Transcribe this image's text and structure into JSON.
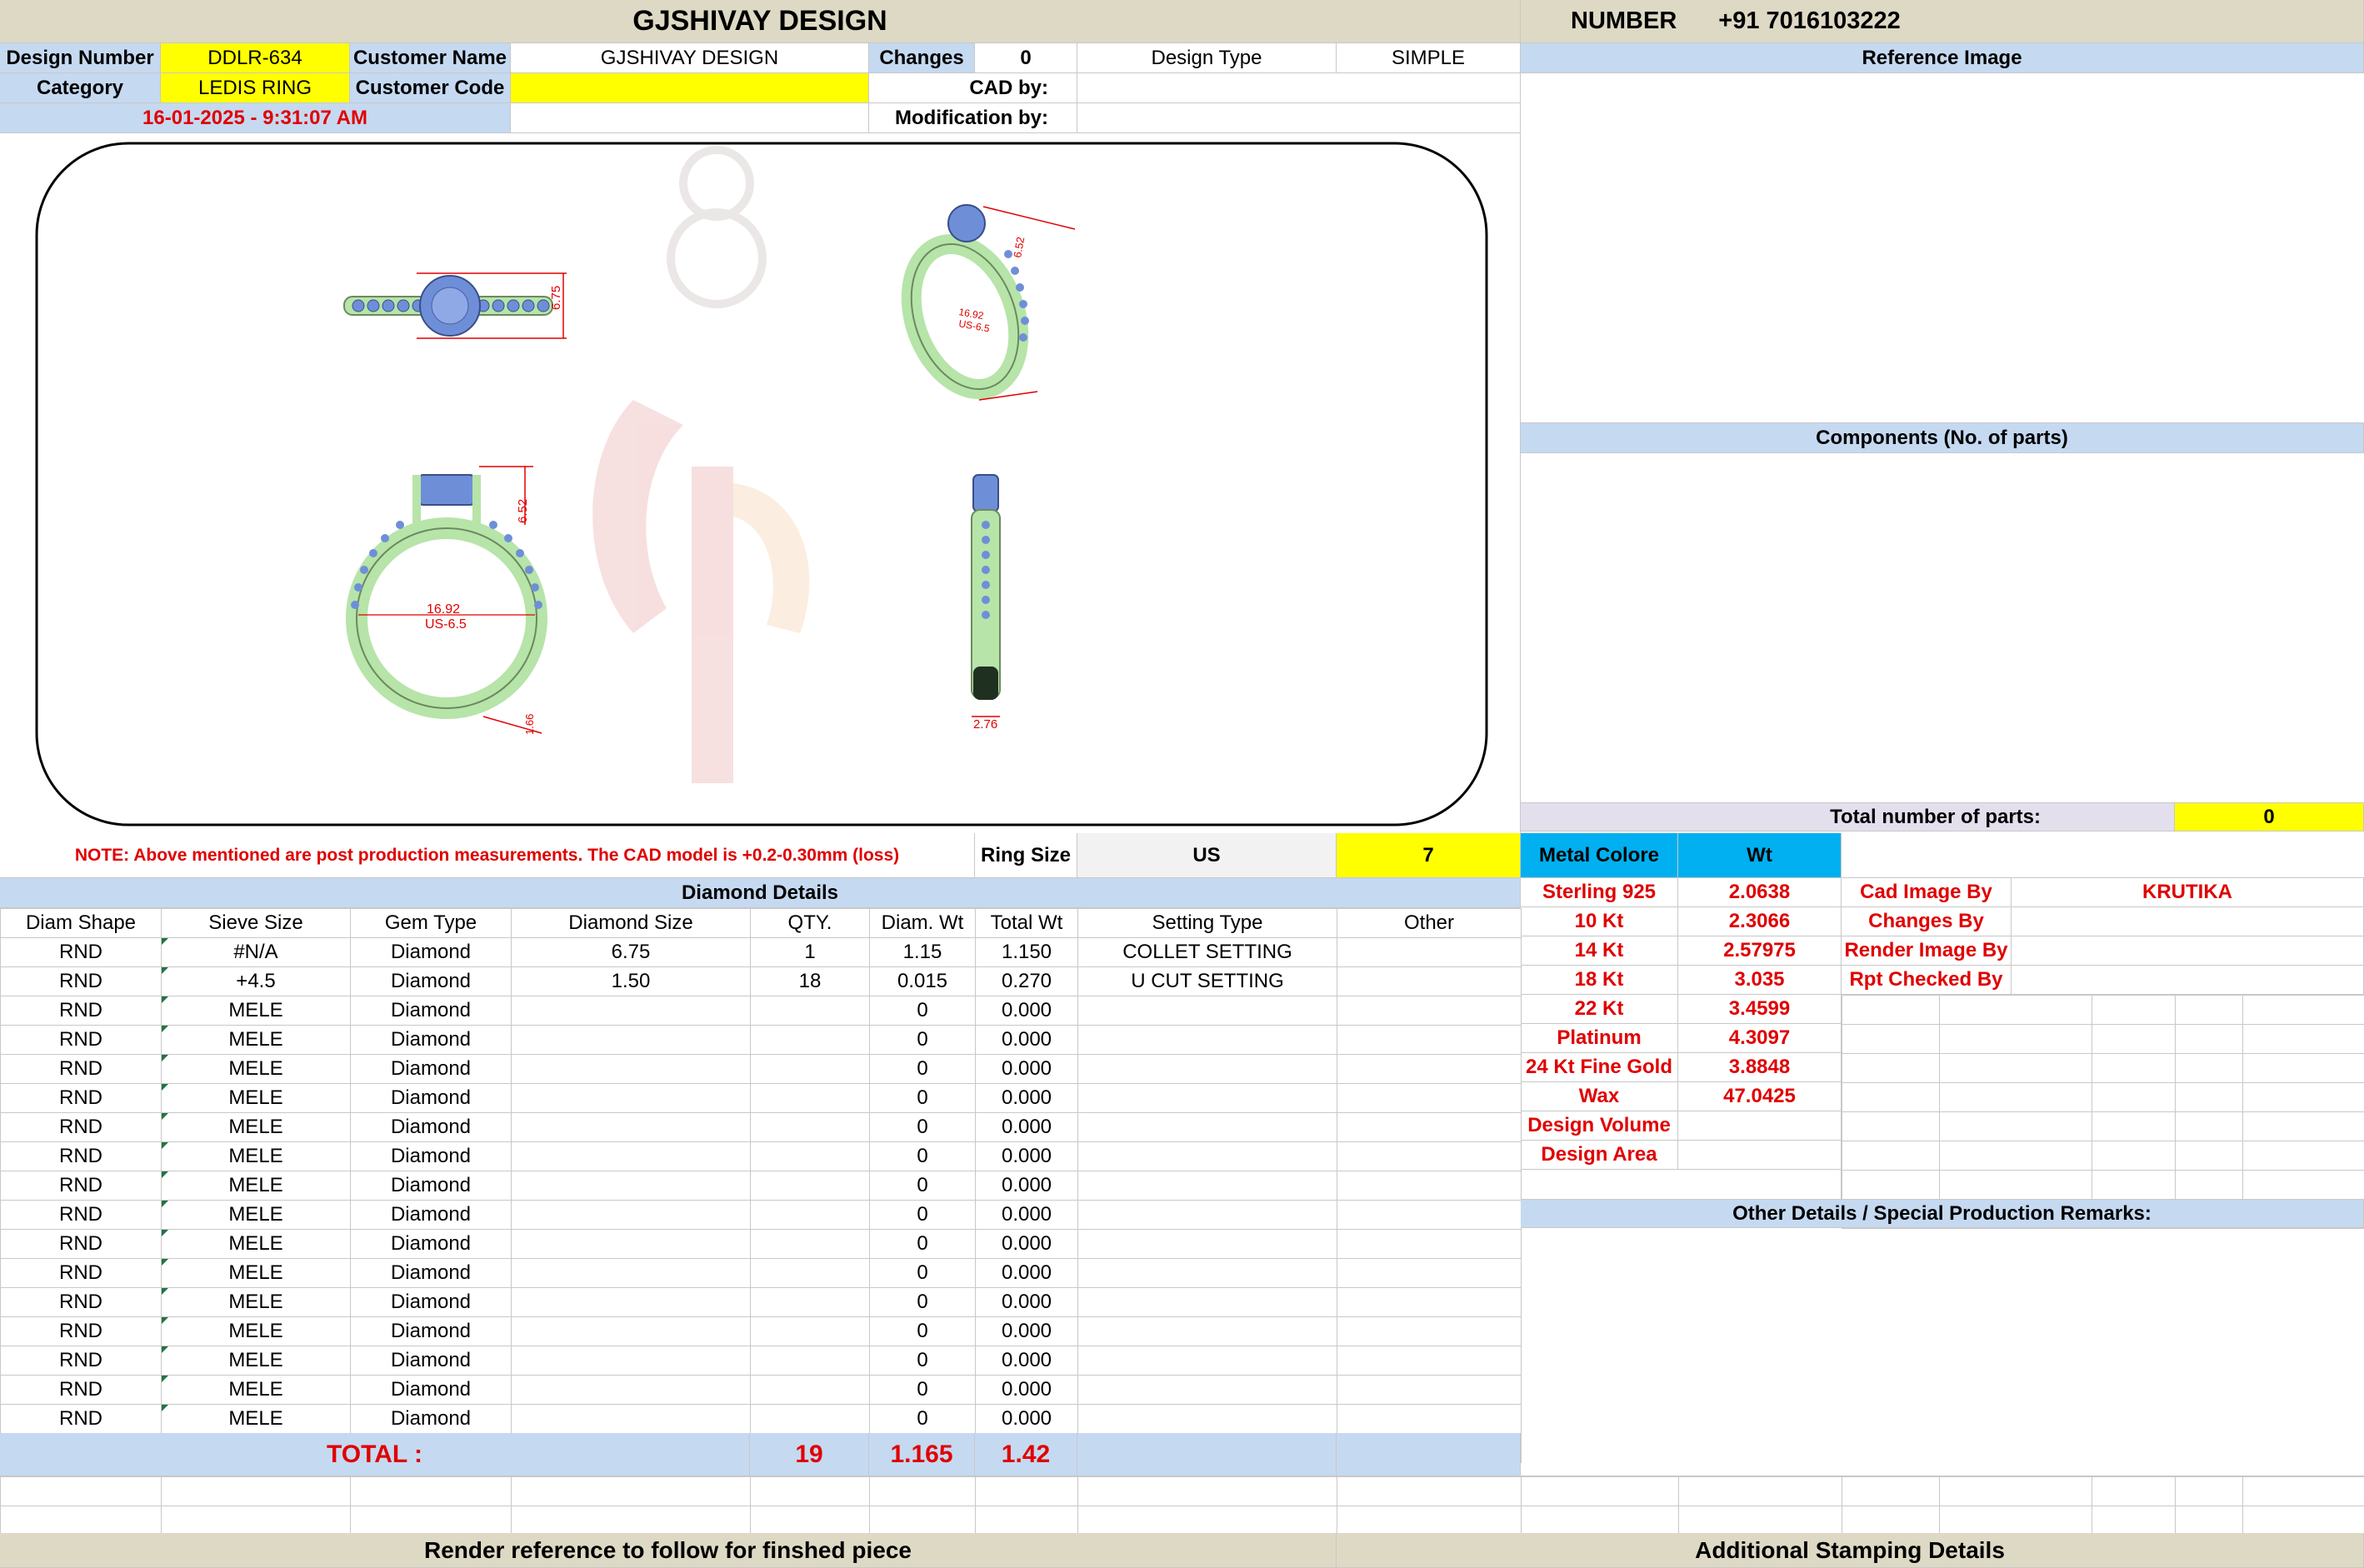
{
  "header": {
    "title": "GJSHIVAY DESIGN",
    "number_label": "NUMBER",
    "number_value": "+91 7016103222"
  },
  "info": {
    "design_number_label": "Design Number",
    "design_number": "DDLR-634",
    "customer_name_label": "Customer Name",
    "customer_name": "GJSHIVAY DESIGN",
    "changes_label": "Changes",
    "changes": "0",
    "design_type_label": "Design Type",
    "design_type": "SIMPLE",
    "category_label": "Category",
    "category": "LEDIS RING",
    "customer_code_label": "Customer Code",
    "customer_code": "",
    "cad_by_label": "CAD by:",
    "cad_by": "",
    "date": "16-01-2025 - 9:31:07 AM",
    "modification_by_label": "Modification by:",
    "modification_by": ""
  },
  "reference": {
    "reference_image_label": "Reference Image",
    "components_label": "Components (No. of parts)",
    "total_parts_label": "Total number of parts:",
    "total_parts": "0"
  },
  "drawing": {
    "top_view_dim": "6.75",
    "persp_dim_1": "6.52",
    "persp_dim_2": "16.92",
    "persp_dim_3": "US-6.5",
    "front_height": "6.52",
    "front_inner_dia": "16.92",
    "front_us_size": "US-6.5",
    "front_shank": "1.66",
    "side_width": "2.76"
  },
  "note": {
    "text": "NOTE: Above mentioned are post production measurements. The CAD model is +0.2-0.30mm (loss)",
    "ring_size_label": "Ring Size",
    "ring_size_unit": "US",
    "ring_size": "7"
  },
  "diamonds": {
    "section_title": "Diamond Details",
    "columns": [
      "Diam Shape",
      "Sieve Size",
      "Gem Type",
      "Diamond Size",
      "QTY.",
      "Diam. Wt",
      "Total Wt",
      "Setting Type",
      "Other"
    ],
    "rows": [
      [
        "RND",
        "#N/A",
        "Diamond",
        "6.75",
        "1",
        "1.15",
        "1.150",
        "COLLET SETTING",
        ""
      ],
      [
        "RND",
        "+4.5",
        "Diamond",
        "1.50",
        "18",
        "0.015",
        "0.270",
        "U CUT SETTING",
        ""
      ],
      [
        "RND",
        "MELE",
        "Diamond",
        "",
        "",
        "0",
        "0.000",
        "",
        ""
      ],
      [
        "RND",
        "MELE",
        "Diamond",
        "",
        "",
        "0",
        "0.000",
        "",
        ""
      ],
      [
        "RND",
        "MELE",
        "Diamond",
        "",
        "",
        "0",
        "0.000",
        "",
        ""
      ],
      [
        "RND",
        "MELE",
        "Diamond",
        "",
        "",
        "0",
        "0.000",
        "",
        ""
      ],
      [
        "RND",
        "MELE",
        "Diamond",
        "",
        "",
        "0",
        "0.000",
        "",
        ""
      ],
      [
        "RND",
        "MELE",
        "Diamond",
        "",
        "",
        "0",
        "0.000",
        "",
        ""
      ],
      [
        "RND",
        "MELE",
        "Diamond",
        "",
        "",
        "0",
        "0.000",
        "",
        ""
      ],
      [
        "RND",
        "MELE",
        "Diamond",
        "",
        "",
        "0",
        "0.000",
        "",
        ""
      ],
      [
        "RND",
        "MELE",
        "Diamond",
        "",
        "",
        "0",
        "0.000",
        "",
        ""
      ],
      [
        "RND",
        "MELE",
        "Diamond",
        "",
        "",
        "0",
        "0.000",
        "",
        ""
      ],
      [
        "RND",
        "MELE",
        "Diamond",
        "",
        "",
        "0",
        "0.000",
        "",
        ""
      ],
      [
        "RND",
        "MELE",
        "Diamond",
        "",
        "",
        "0",
        "0.000",
        "",
        ""
      ],
      [
        "RND",
        "MELE",
        "Diamond",
        "",
        "",
        "0",
        "0.000",
        "",
        ""
      ],
      [
        "RND",
        "MELE",
        "Diamond",
        "",
        "",
        "0",
        "0.000",
        "",
        ""
      ],
      [
        "RND",
        "MELE",
        "Diamond",
        "",
        "",
        "0",
        "0.000",
        "",
        ""
      ],
      [
        "RND",
        "MELE",
        "Diamond",
        "",
        "",
        "0",
        "0.000",
        "",
        ""
      ]
    ],
    "total_label": "TOTAL :",
    "total_qty": "19",
    "total_diam_wt": "1.165",
    "total_wt": "1.42"
  },
  "metal": {
    "header_label": "Metal Colore",
    "wt_label": "Wt",
    "rows": [
      {
        "name": "Sterling 925",
        "wt": "2.0638"
      },
      {
        "name": "10 Kt",
        "wt": "2.3066"
      },
      {
        "name": "14 Kt",
        "wt": "2.57975"
      },
      {
        "name": "18 Kt",
        "wt": "3.035"
      },
      {
        "name": "22 Kt",
        "wt": "3.4599"
      },
      {
        "name": "Platinum",
        "wt": "4.3097"
      },
      {
        "name": "24 Kt Fine Gold",
        "wt": "3.8848"
      },
      {
        "name": "Wax",
        "wt": "47.0425"
      },
      {
        "name": "Design Volume",
        "wt": ""
      },
      {
        "name": "Design Area",
        "wt": ""
      }
    ]
  },
  "staff": {
    "cad_image_by_label": "Cad Image By",
    "cad_image_by": "KRUTIKA",
    "changes_by_label": "Changes By",
    "render_image_by_label": "Render Image By",
    "rpt_checked_by_label": "Rpt Checked By"
  },
  "other_details_label": "Other Details / Special Production Remarks:",
  "footer": {
    "render_reference": "Render reference to follow for finshed piece",
    "stamping": "Additional Stamping Details"
  },
  "colors": {
    "header_tan": "#ddd9c4",
    "highlight_yellow": "#ffff00",
    "section_blue": "#c5d9f1",
    "metal_cyan": "#00b0f0",
    "ring_green": "#b7e4a8",
    "stone_blue": "#6e8fd8",
    "dim_red": "#e00000"
  }
}
